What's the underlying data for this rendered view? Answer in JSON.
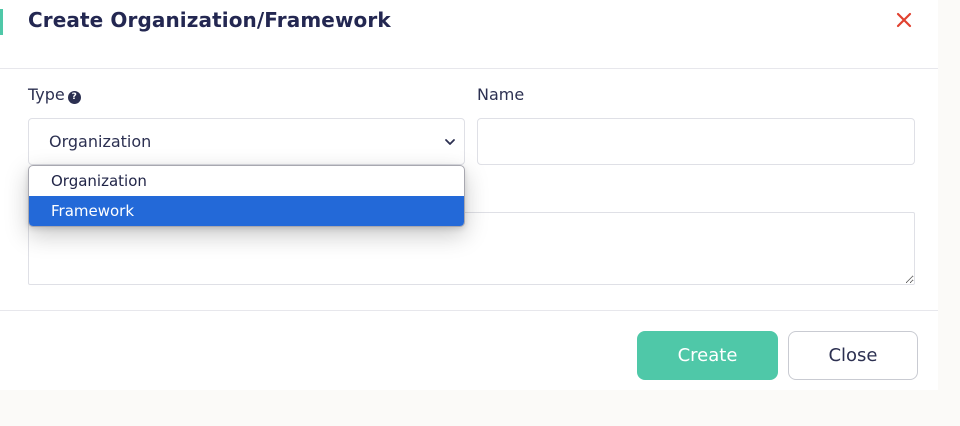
{
  "modal": {
    "title": "Create Organization/Framework",
    "close_icon": "close-x-icon",
    "accent_color": "#4fc8a8",
    "close_color": "#e0412f"
  },
  "form": {
    "type_label": "Type",
    "type_help_icon": "question-circle-icon",
    "type_help_glyph": "?",
    "type_value": "Organization",
    "type_options": [
      "Organization",
      "Framework"
    ],
    "type_highlighted": "Framework",
    "name_label": "Name",
    "name_value": "",
    "description_value": ""
  },
  "footer": {
    "create_label": "Create",
    "close_label": "Close"
  }
}
